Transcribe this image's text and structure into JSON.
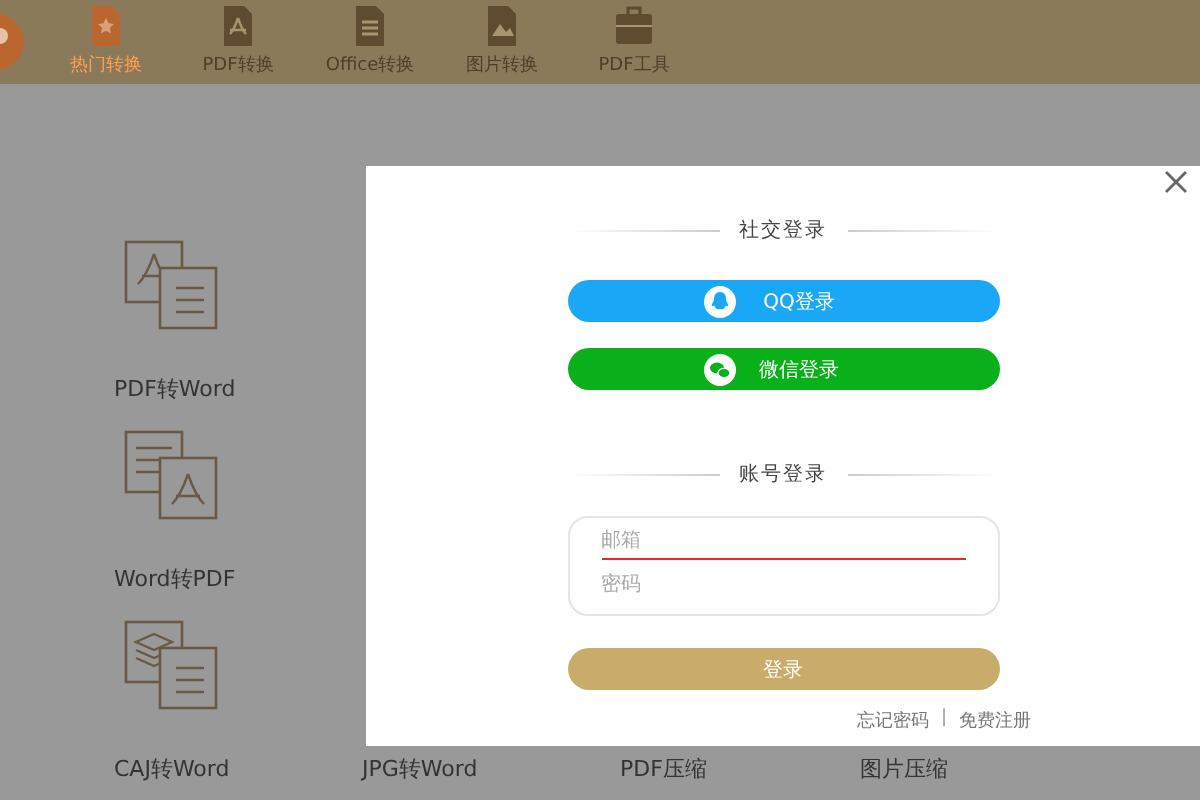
{
  "nav": {
    "items": [
      {
        "label": "热门转换",
        "selected": true
      },
      {
        "label": "PDF转换",
        "selected": false
      },
      {
        "label": "Office转换",
        "selected": false
      },
      {
        "label": "图片转换",
        "selected": false
      },
      {
        "label": "PDF工具",
        "selected": false
      }
    ]
  },
  "tool_rows": [
    [
      {
        "label": "PDF转Word"
      }
    ],
    [
      {
        "label": "Word转PDF"
      }
    ],
    [
      {
        "label": "CAJ转Word"
      },
      {
        "label": "JPG转Word"
      },
      {
        "label": "PDF压缩"
      },
      {
        "label": "图片压缩"
      }
    ]
  ],
  "dialog": {
    "social_title": "社交登录",
    "social_buttons": [
      {
        "kind": "qq",
        "label": "QQ登录"
      },
      {
        "kind": "wechat",
        "label": "微信登录"
      }
    ],
    "account_title": "账号登录",
    "fields": [
      {
        "placeholder": "邮箱",
        "focused": true
      },
      {
        "placeholder": "密码",
        "focused": false
      }
    ],
    "submit": "登录",
    "links": [
      "忘记密码",
      "免费注册"
    ],
    "separator": "|"
  }
}
